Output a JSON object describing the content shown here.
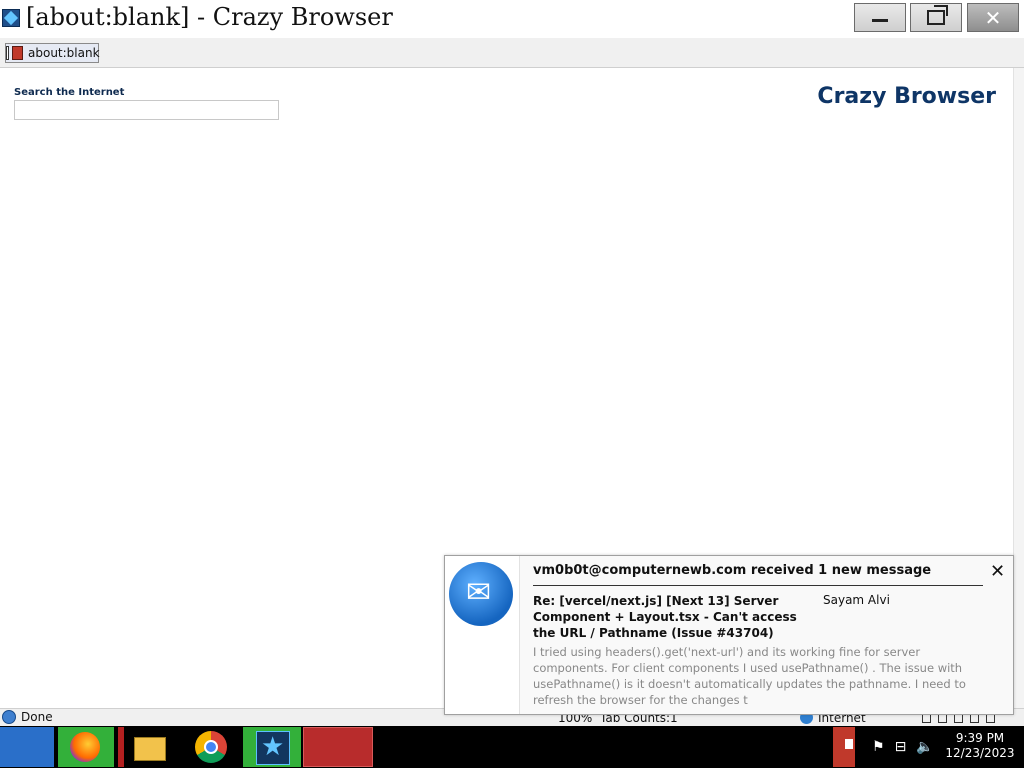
{
  "window": {
    "title": "[about:blank] - Crazy Browser",
    "minimize_glyph": "",
    "maximize_glyph": "",
    "close_glyph": "✕"
  },
  "tabs": [
    {
      "label": "about:blank"
    }
  ],
  "content": {
    "search_label": "Search the Internet",
    "search_value": "",
    "brand": "Crazy Browser"
  },
  "statusbar": {
    "status": "Done",
    "zoom": "100%",
    "tab_count": "Tab Counts:1",
    "zone": "Internet"
  },
  "notification": {
    "header": "vm0b0t@computernewb.com received 1 new message",
    "close_glyph": "✕",
    "subject": "Re: [vercel/next.js] [Next 13] Server Component + Layout.tsx - Can't access the URL / Pathname (Issue #43704)",
    "from": "Sayam Alvi",
    "body": "I tried using headers().get('next-url') and its working fine for server components. For client components I used usePathname() . The issue with usePathname() is it doesn't automatically updates the pathname. I need to refresh the browser for the changes t"
  },
  "taskbar": {
    "clock_time": "9:39 PM",
    "clock_date": "12/23/2023"
  },
  "colors": {
    "brand": "#0e3566",
    "taskbar": "#000000",
    "active_task": "#33b03a"
  }
}
